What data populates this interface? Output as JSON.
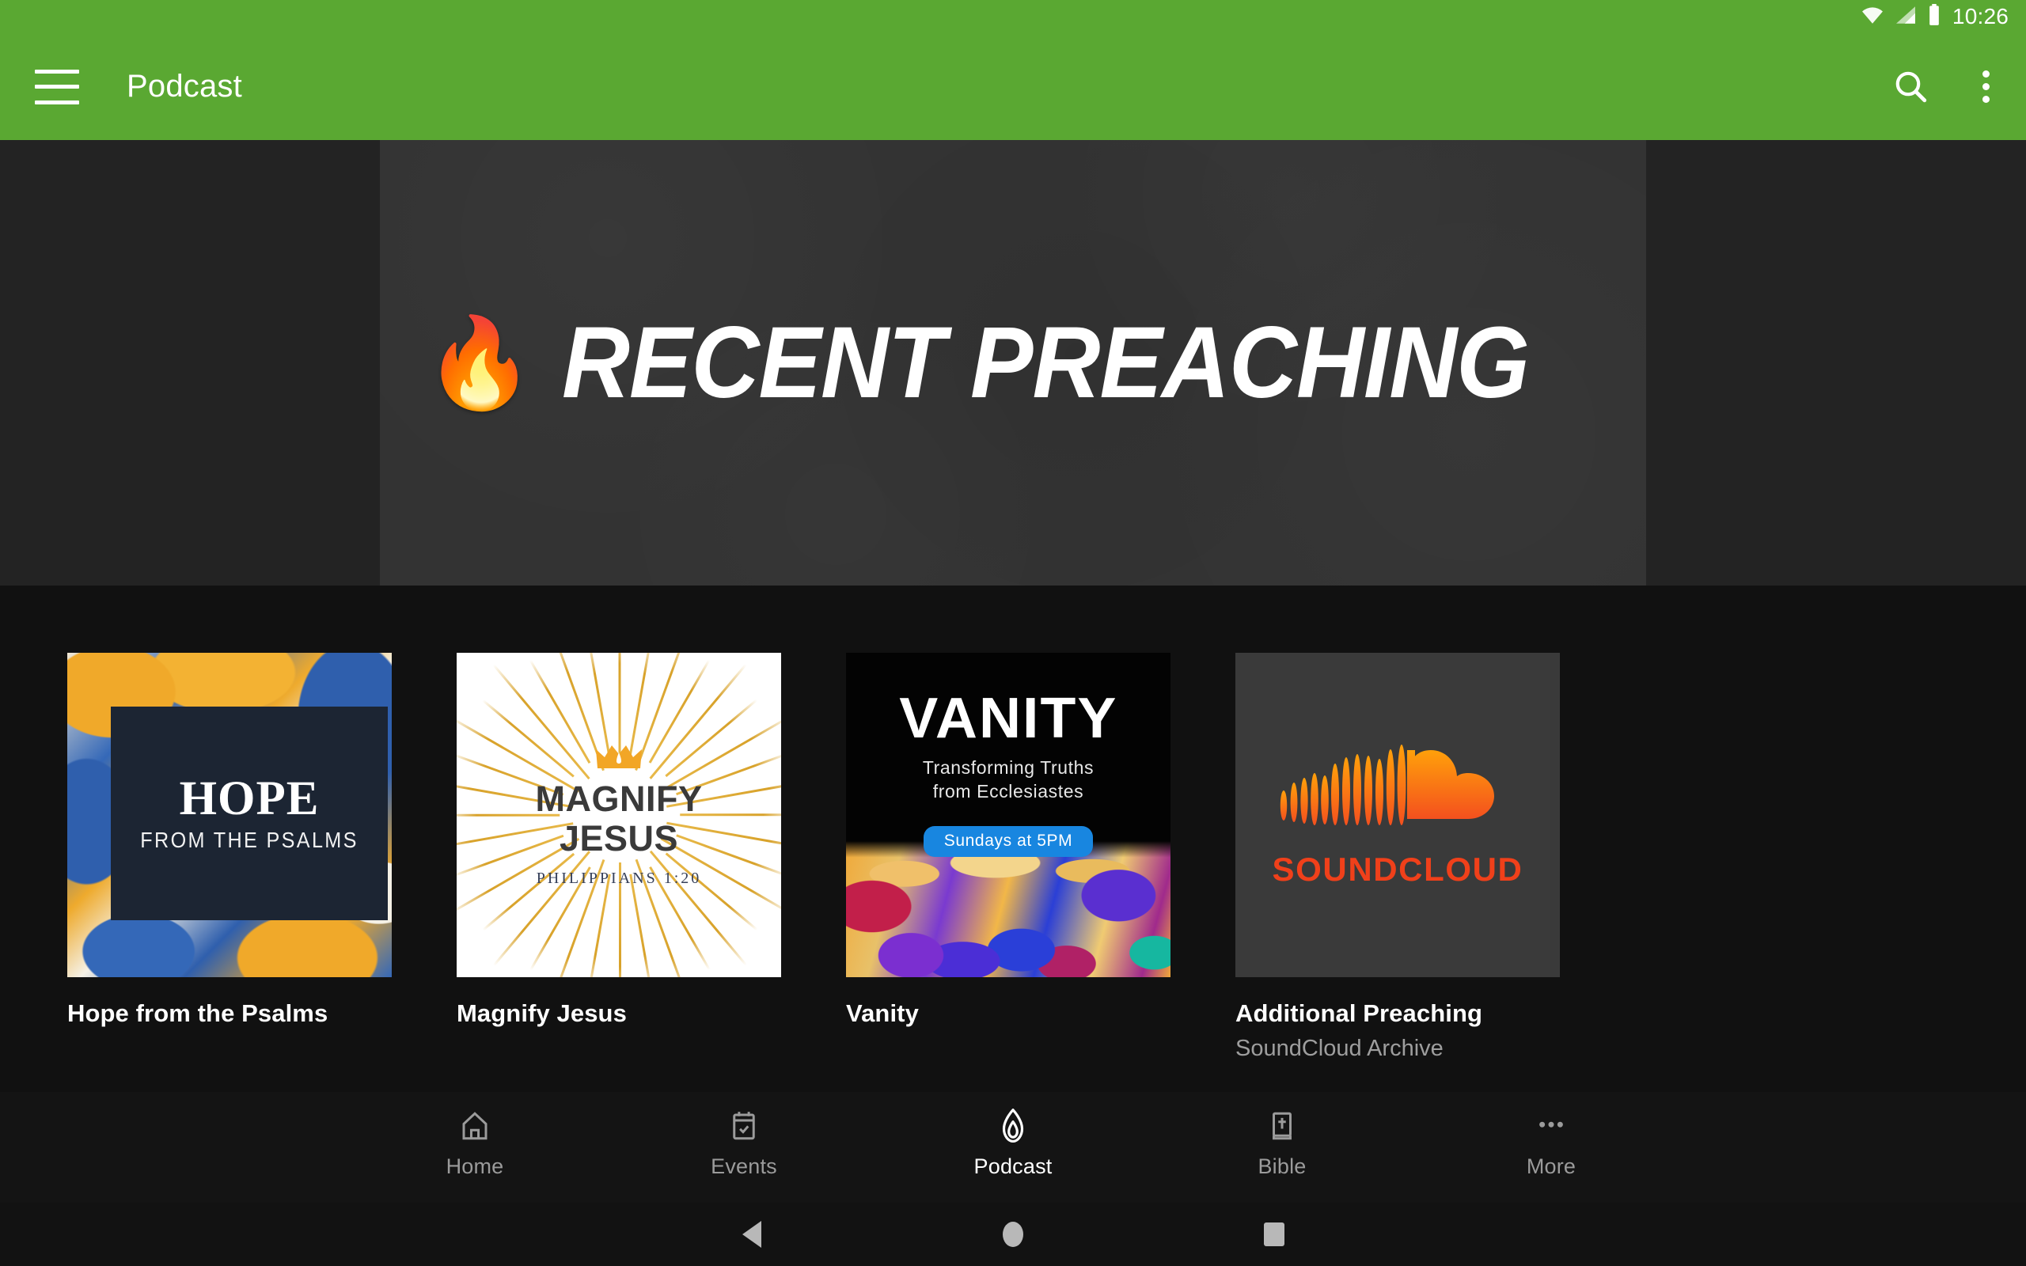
{
  "status_bar": {
    "time": "10:26",
    "icons": [
      "wifi-icon",
      "cellular-signal-icon",
      "battery-icon"
    ]
  },
  "app_bar": {
    "menu_icon": "hamburger-menu-icon",
    "title": "Podcast",
    "actions": [
      {
        "icon": "search-icon",
        "label": "Search"
      },
      {
        "icon": "overflow-menu-icon",
        "label": "More options"
      }
    ],
    "background_color": "#5aa832"
  },
  "hero": {
    "flame_emoji": "🔥",
    "title": "RECENT PREACHING",
    "background_color": "#333333",
    "surround_color": "#232323"
  },
  "cards": [
    {
      "title": "Hope from the Psalms",
      "subtitle": "",
      "artwork": {
        "name": "hope-from-the-psalms-artwork",
        "word": "HOPE",
        "sub": "FROM THE PSALMS",
        "plate_color": "#1c2533",
        "palette": [
          "#3468b8",
          "#f0a92a",
          "#f5f1e6",
          "#151515"
        ]
      }
    },
    {
      "title": "Magnify Jesus",
      "subtitle": "",
      "artwork": {
        "name": "magnify-jesus-artwork",
        "line1": "MAGNIFY",
        "line2": "JESUS",
        "reference": "PHILIPPIANS 1:20",
        "background_color": "#ffffff",
        "accent_color": "#f2a626",
        "text_color": "#3a3a3a"
      }
    },
    {
      "title": "Vanity",
      "subtitle": "",
      "artwork": {
        "name": "vanity-artwork",
        "title": "VANITY",
        "sub_line1": "Transforming Truths",
        "sub_line2": "from Ecclesiastes",
        "badge": "Sundays at 5PM",
        "badge_color": "#1886e0",
        "background_color": "#030303"
      }
    },
    {
      "title": "Additional Preaching",
      "subtitle": "SoundCloud Archive",
      "artwork": {
        "name": "soundcloud-artwork",
        "wordmark": "SOUNDCLOUD",
        "background_color": "#3a3a3a",
        "logo_color": "#f0401a"
      }
    }
  ],
  "tab_bar": {
    "active": "Podcast",
    "tabs": [
      {
        "label": "Home",
        "icon": "home-icon"
      },
      {
        "label": "Events",
        "icon": "calendar-check-icon"
      },
      {
        "label": "Podcast",
        "icon": "flame-icon"
      },
      {
        "label": "Bible",
        "icon": "bible-book-icon"
      },
      {
        "label": "More",
        "icon": "more-dots-icon"
      }
    ]
  },
  "system_nav": {
    "buttons": [
      {
        "name": "back",
        "icon": "triangle-back-icon"
      },
      {
        "name": "home",
        "icon": "circle-home-icon"
      },
      {
        "name": "recents",
        "icon": "square-recents-icon"
      }
    ]
  }
}
